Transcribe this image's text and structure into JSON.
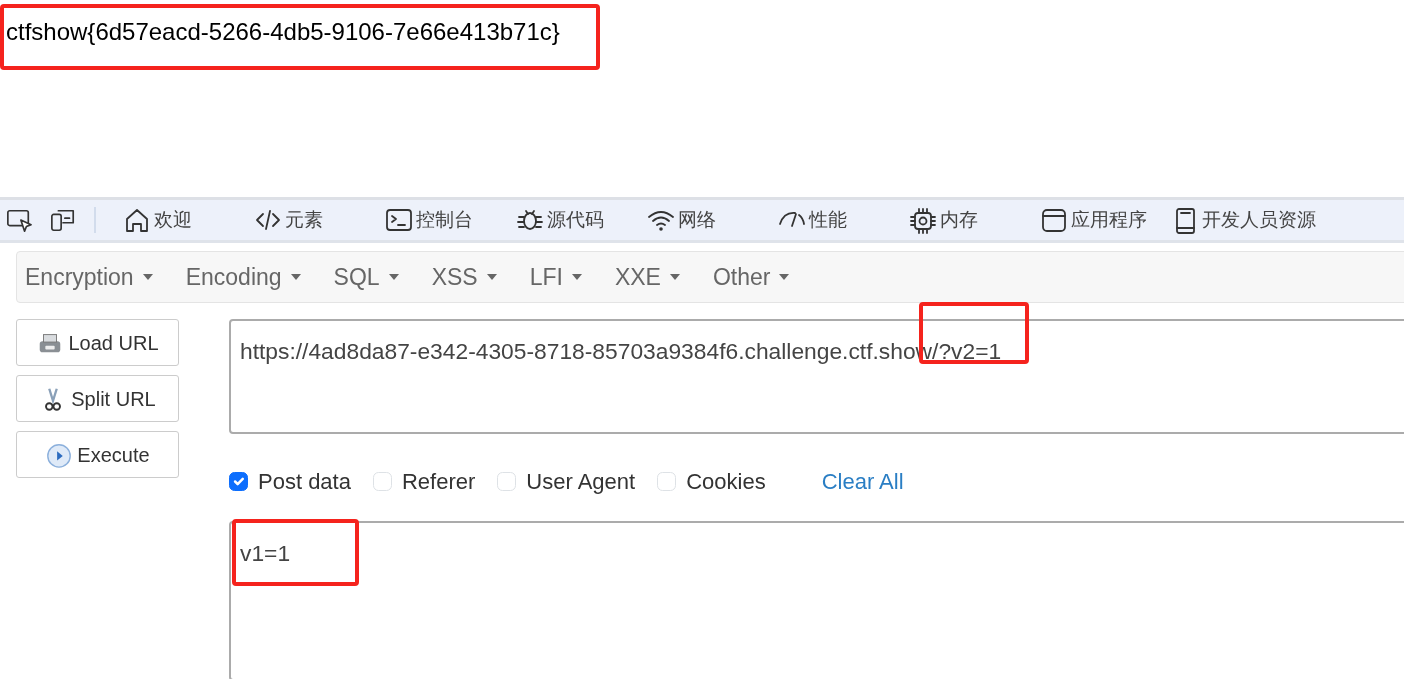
{
  "flag_text": "ctfshow{6d57eacd-5266-4db5-9106-7e66e413b71c}",
  "devtools": {
    "tools": [
      {
        "kind": "inspect"
      },
      {
        "kind": "device"
      }
    ],
    "tabs": [
      {
        "label": "欢迎",
        "kind": "home"
      },
      {
        "label": "元素",
        "kind": "code"
      },
      {
        "label": "控制台",
        "kind": "console"
      },
      {
        "label": "源代码",
        "kind": "bug"
      },
      {
        "label": "网络",
        "kind": "wifi"
      },
      {
        "label": "性能",
        "kind": "gauge"
      },
      {
        "label": "内存",
        "kind": "chip"
      },
      {
        "label": "应用程序",
        "kind": "window"
      },
      {
        "label": "开发人员资源",
        "kind": "book"
      }
    ]
  },
  "hackbar": {
    "menus": [
      "Encryption",
      "Encoding",
      "SQL",
      "XSS",
      "LFI",
      "XXE",
      "Other"
    ],
    "buttons": [
      {
        "label": "Load URL",
        "kind": "load"
      },
      {
        "label": "Split URL",
        "kind": "split"
      },
      {
        "label": "Execute",
        "kind": "execute"
      }
    ],
    "url_value": "https://4ad8da87-e342-4305-8718-85703a9384f6.challenge.ctf.show/?v2=1",
    "options": [
      {
        "label": "Post data",
        "checked": true
      },
      {
        "label": "Referer",
        "checked": false
      },
      {
        "label": "User Agent",
        "checked": false
      },
      {
        "label": "Cookies",
        "checked": false
      }
    ],
    "clear_all": "Clear All",
    "post_value": "v1=1"
  }
}
